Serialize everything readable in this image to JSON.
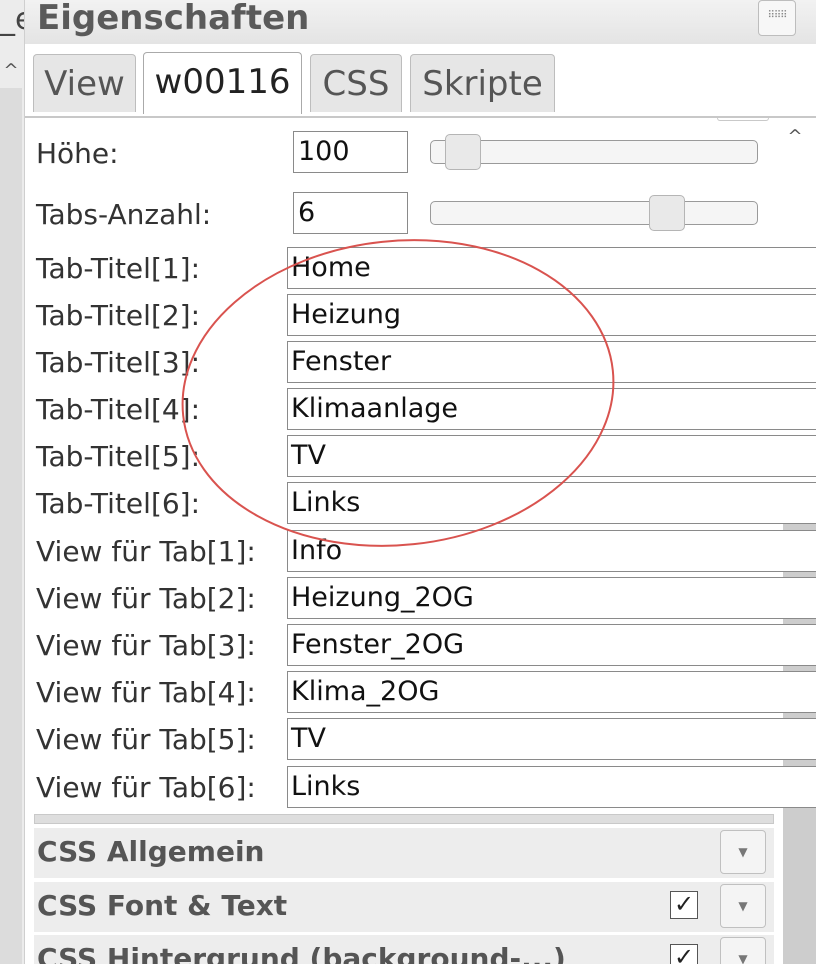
{
  "left": {
    "top_text": "_e",
    "up_glyph": "^"
  },
  "panel": {
    "title": "Eigenschaften",
    "header_button_glyph": "⠿⠿⠿"
  },
  "tabs": [
    "View",
    "w00116",
    "CSS",
    "Skripte"
  ],
  "active_tab": 1,
  "scroll_up_glyph": "^",
  "fields": {
    "hoehe": {
      "label": "Höhe:",
      "value": "100",
      "slider": 0.05
    },
    "tabs_anzahl": {
      "label": "Tabs-Anzahl:",
      "value": "6",
      "slider": 0.75
    }
  },
  "tab_titles": [
    {
      "label": "Tab-Titel[1]:",
      "value": "Home"
    },
    {
      "label": "Tab-Titel[2]:",
      "value": "Heizung"
    },
    {
      "label": "Tab-Titel[3]:",
      "value": "Fenster"
    },
    {
      "label": "Tab-Titel[4]:",
      "value": "Klimaanlage"
    },
    {
      "label": "Tab-Titel[5]:",
      "value": "TV"
    },
    {
      "label": "Tab-Titel[6]:",
      "value": "Links"
    }
  ],
  "tab_views": [
    {
      "label": "View für Tab[1]:",
      "value": "Info"
    },
    {
      "label": "View für Tab[2]:",
      "value": "Heizung_2OG"
    },
    {
      "label": "View für Tab[3]:",
      "value": "Fenster_2OG"
    },
    {
      "label": "View für Tab[4]:",
      "value": "Klima_2OG"
    },
    {
      "label": "View für Tab[5]:",
      "value": "TV"
    },
    {
      "label": "View für Tab[6]:",
      "value": "Links"
    }
  ],
  "sections": [
    {
      "title": "CSS Allgemein",
      "checked": false
    },
    {
      "title": "CSS Font & Text",
      "checked": true
    },
    {
      "title": "CSS Hintergrund (background-...)",
      "checked": true
    }
  ],
  "check_glyph": "✓",
  "dropdown_glyph": "▼",
  "annotation_color": "#d9534f"
}
